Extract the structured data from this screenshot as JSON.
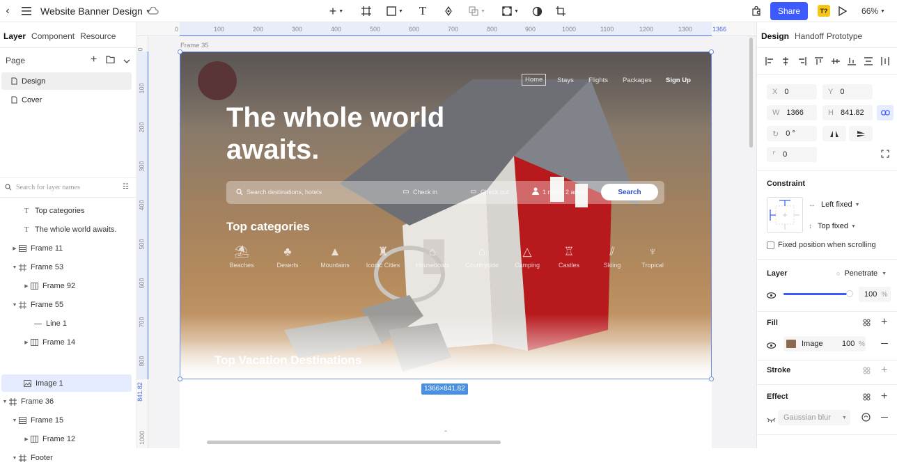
{
  "topbar": {
    "title": "Website Banner Design",
    "share_label": "Share",
    "ai_badge": "T?",
    "zoom": "66%"
  },
  "left_panel": {
    "tabs": [
      "Layer",
      "Component",
      "Resource"
    ],
    "page_header": "Page",
    "pages": [
      "Design",
      "Cover"
    ],
    "search_placeholder": "Search for layer names",
    "layers": [
      {
        "label": "Top categories",
        "icon": "text-icon"
      },
      {
        "label": "The whole world awaits.",
        "icon": "text-icon"
      },
      {
        "label": "Frame 11",
        "icon": "frame-stack-icon"
      },
      {
        "label": "Frame 53",
        "icon": "frame-icon"
      },
      {
        "label": "Frame 92",
        "icon": "frame-cols-icon"
      },
      {
        "label": "Frame 55",
        "icon": "frame-icon"
      },
      {
        "label": "Line 1",
        "icon": "line-icon"
      },
      {
        "label": "Frame 14",
        "icon": "frame-cols-icon"
      },
      {
        "label": "Image 1",
        "icon": "image-icon"
      },
      {
        "label": "Frame 36",
        "icon": "frame-icon"
      },
      {
        "label": "Frame 15",
        "icon": "frame-stack-icon"
      },
      {
        "label": "Frame 12",
        "icon": "frame-cols-icon"
      },
      {
        "label": "Footer",
        "icon": "frame-icon"
      }
    ]
  },
  "ruler": {
    "h_ticks": [
      "0",
      "100",
      "200",
      "300",
      "400",
      "500",
      "600",
      "700",
      "800",
      "900",
      "1000",
      "1100",
      "1200",
      "1300"
    ],
    "h_end": "1366",
    "v_ticks": [
      "0",
      "100",
      "200",
      "300",
      "400",
      "500",
      "600",
      "700",
      "800",
      "1000"
    ],
    "v_height": "841.82"
  },
  "canvas": {
    "frame_label": "Frame 35",
    "size_badge": "1366×841.82",
    "hero": {
      "title_line1": "The whole world",
      "title_line2": "awaits.",
      "nav": [
        "Home",
        "Stays",
        "Flights",
        "Packages",
        "Sign Up"
      ],
      "search_placeholder": "Search destinations, hotels",
      "check_in": "Check in",
      "check_out": "Check out",
      "guests": "1 room, 2 adults",
      "search_button": "Search",
      "categories_title": "Top categories",
      "categories": [
        "Beaches",
        "Deserts",
        "Mountains",
        "Iconic Cities",
        "Houseboats",
        "Countryside",
        "Camping",
        "Castles",
        "Skiing",
        "Tropical"
      ],
      "destinations_title": "Top Vacation Destinations"
    }
  },
  "right_panel": {
    "tabs": [
      "Design",
      "Handoff",
      "Prototype"
    ],
    "x": "0",
    "y": "0",
    "w": "1366",
    "h": "841.82",
    "rotation": "0 °",
    "radius": "0",
    "constraint_title": "Constraint",
    "constraint_h": "Left fixed",
    "constraint_v": "Top fixed",
    "fixed_position_label": "Fixed position when scrolling",
    "layer_title": "Layer",
    "blend_mode": "Penetrate",
    "opacity": "100",
    "fill_title": "Fill",
    "fill_type": "Image",
    "fill_opacity": "100",
    "stroke_title": "Stroke",
    "effect_title": "Effect",
    "effect_type": "Gaussian blur",
    "percent": "%"
  },
  "colors": {
    "accent": "#3d5afe",
    "selection": "#4a90e2",
    "badge_yellow": "#f5c518"
  }
}
